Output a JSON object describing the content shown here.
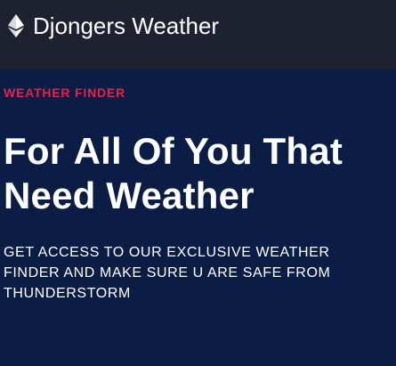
{
  "navbar": {
    "brand_label": "Djongers Weather",
    "brand_icon": "ethereum-diamond-icon"
  },
  "hero": {
    "eyebrow": "WEATHER FINDER",
    "headline_line1": "For All Of You That",
    "headline_line2": "Need Weather",
    "lead_line1": "GET ACCESS TO OUR EXCLUSIVE WEATHER",
    "lead_line2": "FINDER AND MAKE SURE U ARE SAFE FROM",
    "lead_line3": "THUNDERSTORM"
  },
  "colors": {
    "navbar_bg": "#1e2230",
    "hero_bg": "#0b1d45",
    "accent": "#e0224f",
    "text": "#ffffff"
  }
}
